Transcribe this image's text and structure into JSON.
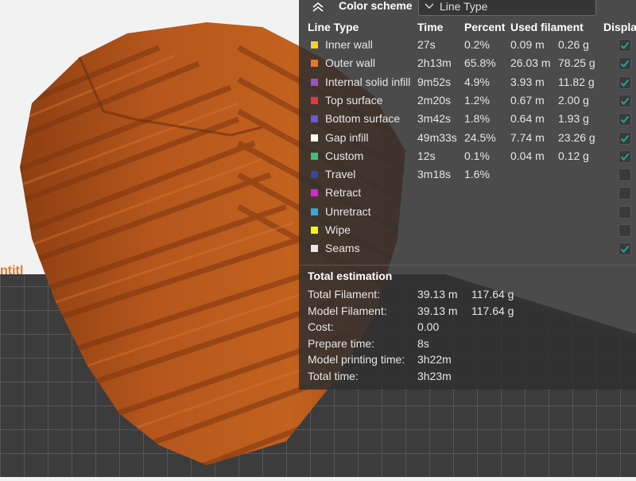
{
  "viewport": {
    "plate_label_partial": "ntitl",
    "model_color": "#b5561c"
  },
  "panel": {
    "color_scheme_label": "Color scheme",
    "color_scheme_value": "Line Type",
    "headers": {
      "line_type": "Line Type",
      "time": "Time",
      "percent": "Percent",
      "used_filament": "Used filament",
      "display": "Displa"
    },
    "rows": [
      {
        "name": "Inner wall",
        "color": "#f2d22c",
        "time": "27s",
        "percent": "0.2%",
        "length": "0.09 m",
        "weight": "0.26 g",
        "checked": true
      },
      {
        "name": "Outer wall",
        "color": "#e8772a",
        "time": "2h13m",
        "percent": "65.8%",
        "length": "26.03 m",
        "weight": "78.25 g",
        "checked": true
      },
      {
        "name": "Internal solid infill",
        "color": "#9a52c4",
        "time": "9m52s",
        "percent": "4.9%",
        "length": "3.93 m",
        "weight": "11.82 g",
        "checked": true
      },
      {
        "name": "Top surface",
        "color": "#e6393c",
        "time": "2m20s",
        "percent": "1.2%",
        "length": "0.67 m",
        "weight": "2.00 g",
        "checked": true
      },
      {
        "name": "Bottom surface",
        "color": "#6a5ad1",
        "time": "3m42s",
        "percent": "1.8%",
        "length": "0.64 m",
        "weight": "1.93 g",
        "checked": true
      },
      {
        "name": "Gap infill",
        "color": "#ffffff",
        "time": "49m33s",
        "percent": "24.5%",
        "length": "7.74 m",
        "weight": "23.26 g",
        "checked": true
      },
      {
        "name": "Custom",
        "color": "#3fbf7a",
        "time": "12s",
        "percent": "0.1%",
        "length": "0.04 m",
        "weight": "0.12 g",
        "checked": true
      },
      {
        "name": "Travel",
        "color": "#3448a8",
        "time": "3m18s",
        "percent": "1.6%",
        "length": "",
        "weight": "",
        "checked": false
      },
      {
        "name": "Retract",
        "color": "#e020d8",
        "time": "",
        "percent": "",
        "length": "",
        "weight": "",
        "checked": false
      },
      {
        "name": "Unretract",
        "color": "#35a9d8",
        "time": "",
        "percent": "",
        "length": "",
        "weight": "",
        "checked": false
      },
      {
        "name": "Wipe",
        "color": "#f5f50a",
        "time": "",
        "percent": "",
        "length": "",
        "weight": "",
        "checked": false
      },
      {
        "name": "Seams",
        "color": "#e8e8e8",
        "time": "",
        "percent": "",
        "length": "",
        "weight": "",
        "checked": true
      }
    ],
    "total_estimation": {
      "title": "Total estimation",
      "items": [
        {
          "label": "Total Filament:",
          "v1": "39.13 m",
          "v2": "117.64 g"
        },
        {
          "label": "Model Filament:",
          "v1": "39.13 m",
          "v2": "117.64 g"
        },
        {
          "label": "Cost:",
          "v1": "0.00",
          "v2": ""
        },
        {
          "label": "Prepare time:",
          "v1": "8s",
          "v2": ""
        },
        {
          "label": "Model printing time:",
          "v1": "3h22m",
          "v2": ""
        },
        {
          "label": "Total time:",
          "v1": "3h23m",
          "v2": ""
        }
      ]
    },
    "check_color": "#19a89a"
  }
}
